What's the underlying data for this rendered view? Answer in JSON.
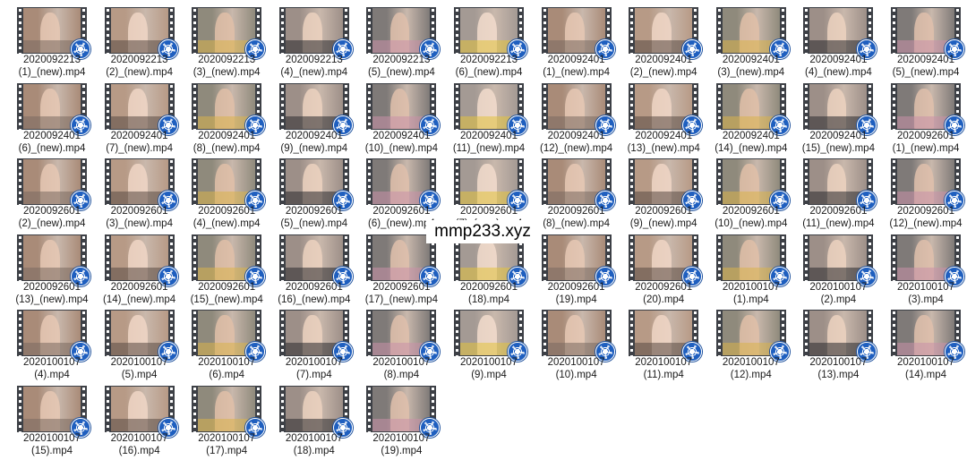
{
  "watermark": "mmp233.xyz",
  "colors": {
    "badge": "#1f5fbf",
    "film": "#3d4046"
  },
  "file_icon": "video-file-icon",
  "badge_icon": "media-player-reel-icon",
  "files": [
    [
      "2020092213",
      "(1)_(new).mp4"
    ],
    [
      "2020092213",
      "(2)_(new).mp4"
    ],
    [
      "2020092213",
      "(3)_(new).mp4"
    ],
    [
      "2020092213",
      "(4)_(new).mp4"
    ],
    [
      "2020092213",
      "(5)_(new).mp4"
    ],
    [
      "2020092213",
      "(6)_(new).mp4"
    ],
    [
      "2020092401",
      "(1)_(new).mp4"
    ],
    [
      "2020092401",
      "(2)_(new).mp4"
    ],
    [
      "2020092401",
      "(3)_(new).mp4"
    ],
    [
      "2020092401",
      "(4)_(new).mp4"
    ],
    [
      "2020092401",
      "(5)_(new).mp4"
    ],
    [
      "2020092401",
      "(6)_(new).mp4"
    ],
    [
      "2020092401",
      "(7)_(new).mp4"
    ],
    [
      "2020092401",
      "(8)_(new).mp4"
    ],
    [
      "2020092401",
      "(9)_(new).mp4"
    ],
    [
      "2020092401",
      "(10)_(new).mp4"
    ],
    [
      "2020092401",
      "(11)_(new).mp4"
    ],
    [
      "2020092401",
      "(12)_(new).mp4"
    ],
    [
      "2020092401",
      "(13)_(new).mp4"
    ],
    [
      "2020092401",
      "(14)_(new).mp4"
    ],
    [
      "2020092401",
      "(15)_(new).mp4"
    ],
    [
      "2020092601",
      "(1)_(new).mp4"
    ],
    [
      "2020092601",
      "(2)_(new).mp4"
    ],
    [
      "2020092601",
      "(3)_(new).mp4"
    ],
    [
      "2020092601",
      "(4)_(new).mp4"
    ],
    [
      "2020092601",
      "(5)_(new).mp4"
    ],
    [
      "2020092601",
      "(6)_(new).mp4"
    ],
    [
      "2020092601",
      "(7)_(new).mp4"
    ],
    [
      "2020092601",
      "(8)_(new).mp4"
    ],
    [
      "2020092601",
      "(9)_(new).mp4"
    ],
    [
      "2020092601",
      "(10)_(new).mp4"
    ],
    [
      "2020092601",
      "(11)_(new).mp4"
    ],
    [
      "2020092601",
      "(12)_(new).mp4"
    ],
    [
      "2020092601",
      "(13)_(new).mp4"
    ],
    [
      "2020092601",
      "(14)_(new).mp4"
    ],
    [
      "2020092601",
      "(15)_(new).mp4"
    ],
    [
      "2020092601",
      "(16)_(new).mp4"
    ],
    [
      "2020092601",
      "(17)_(new).mp4"
    ],
    [
      "2020092601",
      "(18).mp4"
    ],
    [
      "2020092601",
      "(19).mp4"
    ],
    [
      "2020092601",
      "(20).mp4"
    ],
    [
      "2020100107",
      "(1).mp4"
    ],
    [
      "2020100107",
      "(2).mp4"
    ],
    [
      "2020100107",
      "(3).mp4"
    ],
    [
      "2020100107",
      "(4).mp4"
    ],
    [
      "2020100107",
      "(5).mp4"
    ],
    [
      "2020100107",
      "(6).mp4"
    ],
    [
      "2020100107",
      "(7).mp4"
    ],
    [
      "2020100107",
      "(8).mp4"
    ],
    [
      "2020100107",
      "(9).mp4"
    ],
    [
      "2020100107",
      "(10).mp4"
    ],
    [
      "2020100107",
      "(11).mp4"
    ],
    [
      "2020100107",
      "(12).mp4"
    ],
    [
      "2020100107",
      "(13).mp4"
    ],
    [
      "2020100107",
      "(14).mp4"
    ],
    [
      "2020100107",
      "(15).mp4"
    ],
    [
      "2020100107",
      "(16).mp4"
    ],
    [
      "2020100107",
      "(17).mp4"
    ],
    [
      "2020100107",
      "(18).mp4"
    ],
    [
      "2020100107",
      "(19).mp4"
    ]
  ]
}
